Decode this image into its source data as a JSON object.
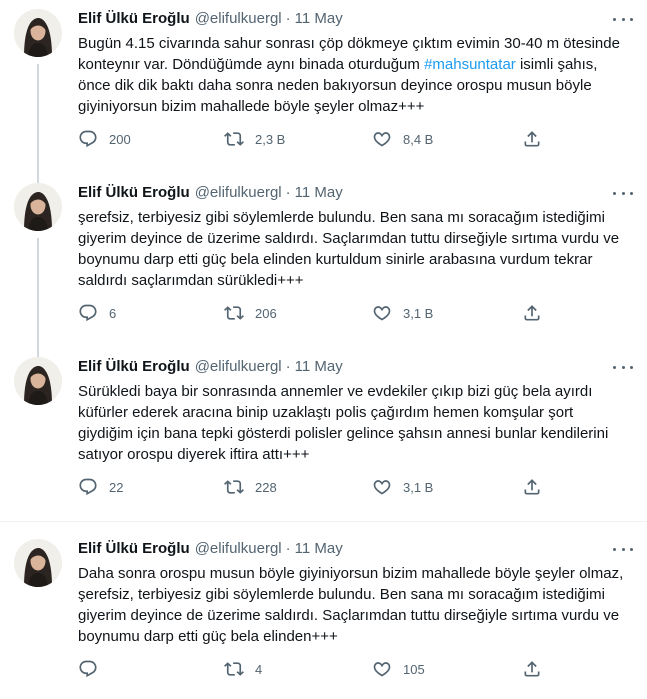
{
  "author": {
    "name": "Elif Ülkü Eroğlu",
    "handle": "@elifulkuergl",
    "separator": "·"
  },
  "tweets": [
    {
      "date": "11 May",
      "text_before": "Bugün 4.15 civarında sahur sonrası çöp dökmeye çıktım evimin 30-40 m ötesinde konteynır var. Döndüğümde aynı binada oturduğum ",
      "hashtag": "#mahsuntatar",
      "text_after": " isimli şahıs, önce dik dik baktı  daha sonra neden bakıyorsun deyince orospu musun böyle giyiniyorsun bizim mahallede böyle şeyler olmaz+++",
      "replies": "200",
      "retweets": "2,3 B",
      "likes": "8,4 B"
    },
    {
      "date": "11 May",
      "text_before": "şerefsiz, terbiyesiz gibi söylemlerde bulundu. Ben sana mı soracağım istediğimi giyerim deyince de üzerime saldırdı. Saçlarımdan tuttu dirseğiyle sırtıma vurdu ve boynumu darp etti güç bela elinden kurtuldum sinirle arabasına vurdum tekrar saldırdı saçlarımdan sürükledi+++",
      "hashtag": "",
      "text_after": "",
      "replies": "6",
      "retweets": "206",
      "likes": "3,1 B"
    },
    {
      "date": "11 May",
      "text_before": "Sürükledi baya bir sonrasında annemler ve evdekiler çıkıp bizi güç bela ayırdı küfürler ederek aracına binip uzaklaştı polis çağırdım hemen komşular şort giydiğim için bana tepki gösterdi polisler gelince şahsın annesi bunlar kendilerini satıyor orospu diyerek iftira attı+++",
      "hashtag": "",
      "text_after": "",
      "replies": "22",
      "retweets": "228",
      "likes": "3,1 B"
    },
    {
      "date": "11 May",
      "text_before": "Daha sonra orospu musun böyle giyiniyorsun bizim mahallede böyle şeyler olmaz, şerefsiz, terbiyesiz gibi söylemlerde bulundu. Ben sana mı soracağım istediğimi giyerim deyince de üzerime saldırdı. Saçlarımdan tuttu dirseğiyle sırtıma vurdu ve boynumu darp etti güç bela elinden+++",
      "hashtag": "",
      "text_after": "",
      "replies": "",
      "retweets": "4",
      "likes": "105"
    }
  ],
  "icons": {
    "reply": "speech-bubble-icon",
    "retweet": "retweet-arrows-icon",
    "like": "heart-outline-icon",
    "share": "share-upload-icon",
    "more": "ellipsis-icon"
  },
  "colors": {
    "text": "#0f1419",
    "secondary": "#536471",
    "hashtag": "#1d9bf0",
    "thread_line": "#cfd9de",
    "divider": "#eff3f4"
  }
}
